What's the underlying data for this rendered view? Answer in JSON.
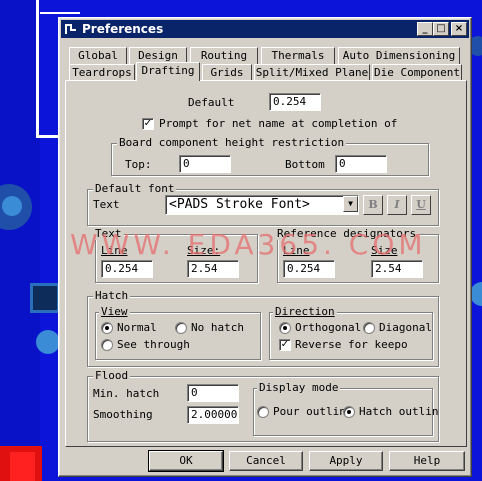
{
  "window": {
    "title": "Preferences"
  },
  "tabs_row1": [
    "Global",
    "Design",
    "Routing",
    "Thermals",
    "Auto Dimensioning"
  ],
  "tabs_row2": [
    "Teardrops",
    "Drafting",
    "Grids",
    "Split/Mixed Plane",
    "Die Component"
  ],
  "active_tab": "Drafting",
  "default": {
    "label": "Default",
    "value": "0.254"
  },
  "prompt_checkbox": {
    "label": "Prompt for net name at completion of",
    "checked": true
  },
  "height_restriction": {
    "title": "Board component height restriction",
    "top_label": "Top:",
    "top_value": "0",
    "bottom_label": "Bottom",
    "bottom_value": "0"
  },
  "default_font": {
    "title": "Default font",
    "text_label": "Text",
    "font_value": "<PADS Stroke Font>",
    "bold": "B",
    "italic": "I",
    "underline": "U"
  },
  "text_group": {
    "title": "Text",
    "line_label": "Line",
    "size_label": "Size:",
    "line_value": "0.254",
    "size_value": "2.54"
  },
  "refdes_group": {
    "title": "Reference designators",
    "line_label": "Line",
    "size_label": "Size",
    "line_value": "0.254",
    "size_value": "2.54"
  },
  "hatch": {
    "title": "Hatch",
    "view_title": "View",
    "view_options": [
      "Normal",
      "No hatch",
      "See through"
    ],
    "view_selected": "Normal",
    "direction_title": "Direction",
    "direction_options": [
      "Orthogonal",
      "Diagonal"
    ],
    "direction_selected": "Orthogonal",
    "reverse_label": "Reverse for keepo",
    "reverse_checked": true
  },
  "flood": {
    "title": "Flood",
    "min_hatch_label": "Min. hatch",
    "min_hatch_value": "0",
    "smoothing_label": "Smoothing",
    "smoothing_value": "2.000000",
    "display_mode_title": "Display mode",
    "display_options": [
      "Pour outlin",
      "Hatch outlin"
    ],
    "display_selected": "Hatch outlin"
  },
  "buttons": {
    "ok": "OK",
    "cancel": "Cancel",
    "apply": "Apply",
    "help": "Help"
  },
  "watermark": "WWW. EDA365. COM",
  "title_buttons": {
    "minimize": "_",
    "maximize": "□",
    "close": "×"
  }
}
